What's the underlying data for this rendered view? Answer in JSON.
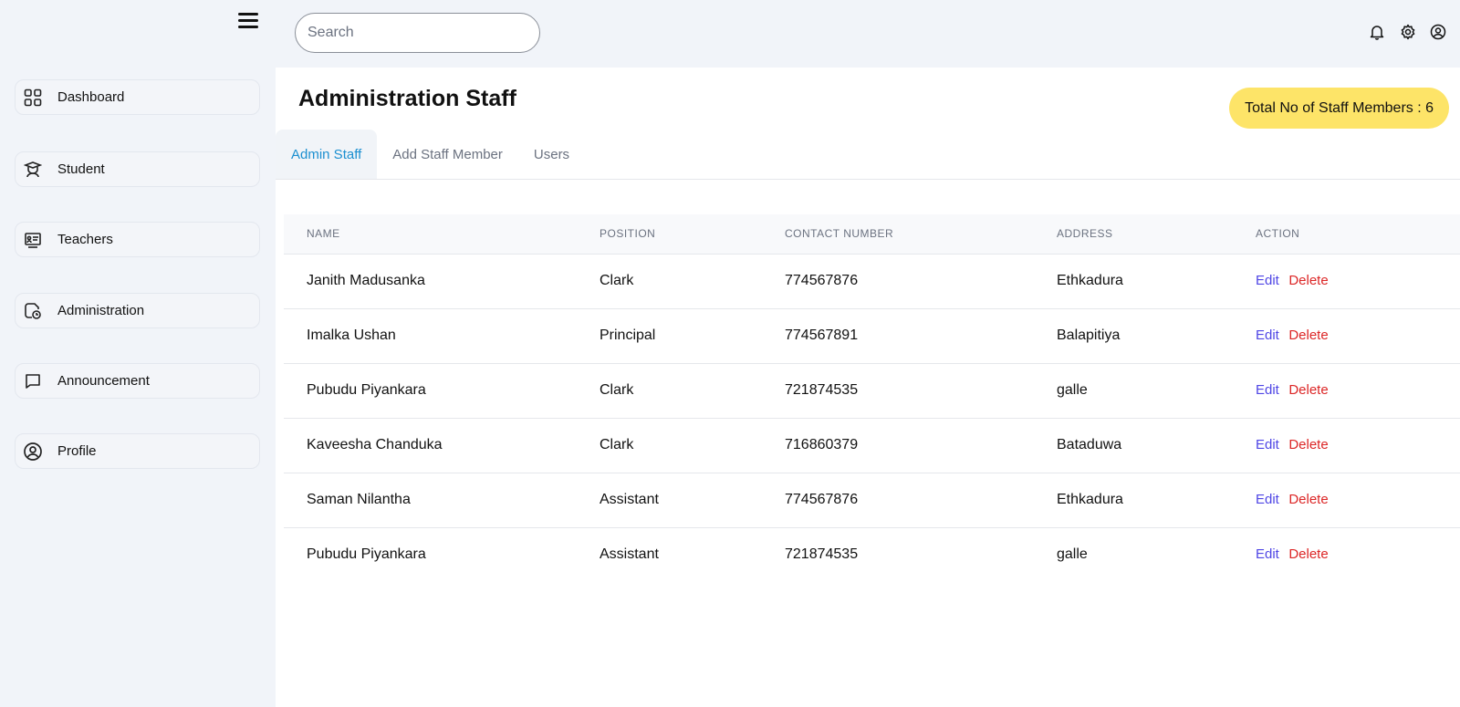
{
  "sidebar": {
    "items": [
      {
        "label": "Dashboard",
        "icon": "grid-icon"
      },
      {
        "label": "Student",
        "icon": "student-icon"
      },
      {
        "label": "Teachers",
        "icon": "teacher-board-icon"
      },
      {
        "label": "Administration",
        "icon": "admin-icon"
      },
      {
        "label": "Announcement",
        "icon": "chat-icon"
      },
      {
        "label": "Profile",
        "icon": "user-circle-icon"
      }
    ]
  },
  "topbar": {
    "search_placeholder": "Search",
    "icons": [
      "bell-icon",
      "gear-icon",
      "user-icon"
    ]
  },
  "main": {
    "title": "Administration Staff",
    "total_badge": "Total No of Staff Members : 6",
    "tabs": [
      {
        "label": "Admin Staff",
        "active": true
      },
      {
        "label": "Add Staff Member",
        "active": false
      },
      {
        "label": "Users",
        "active": false
      }
    ],
    "table": {
      "headers": [
        "NAME",
        "POSITION",
        "CONTACT NUMBER",
        "ADDRESS",
        "ACTION"
      ],
      "rows": [
        {
          "name": "Janith Madusanka",
          "position": "Clark",
          "contact": "774567876",
          "address": "Ethkadura"
        },
        {
          "name": "Imalka Ushan",
          "position": "Principal",
          "contact": "774567891",
          "address": "Balapitiya"
        },
        {
          "name": "Pubudu Piyankara",
          "position": "Clark",
          "contact": "721874535",
          "address": "galle"
        },
        {
          "name": "Kaveesha Chanduka",
          "position": "Clark",
          "contact": "716860379",
          "address": "Bataduwa"
        },
        {
          "name": "Saman Nilantha",
          "position": "Assistant",
          "contact": "774567876",
          "address": "Ethkadura"
        },
        {
          "name": "Pubudu Piyankara",
          "position": "Assistant",
          "contact": "721874535",
          "address": "galle"
        }
      ],
      "edit_label": "Edit",
      "delete_label": "Delete"
    }
  },
  "colors": {
    "active_tab": "#1b8fd0",
    "badge_bg": "#fde468",
    "edit": "#4f46e5",
    "delete": "#dc2626"
  }
}
